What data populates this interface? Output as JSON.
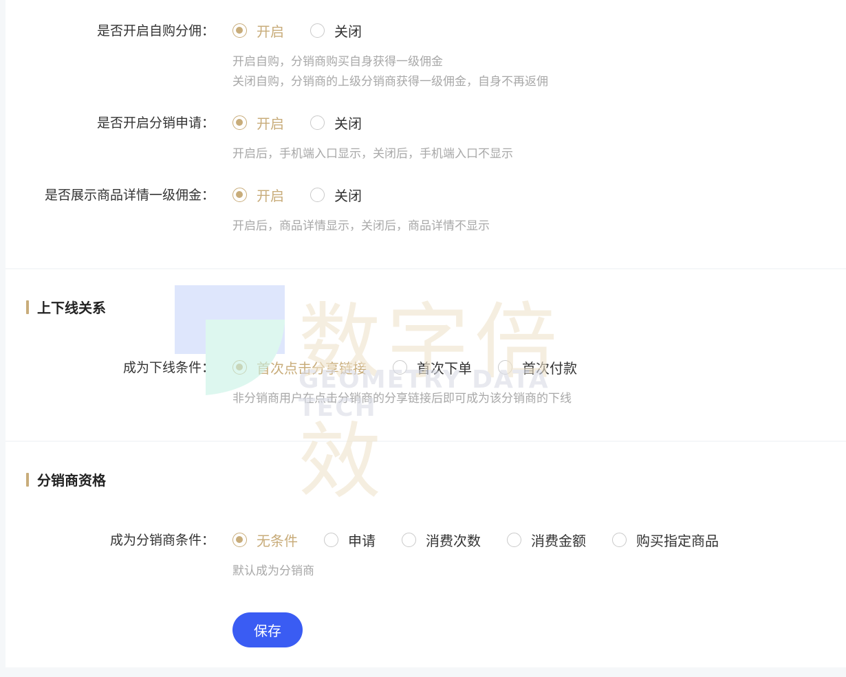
{
  "settings": {
    "self_purchase": {
      "label": "是否开启自购分佣：",
      "options": [
        "开启",
        "关闭"
      ],
      "selected": 0,
      "hint_lines": [
        "开启自购，分销商购买自身获得一级佣金",
        "关闭自购，分销商的上级分销商获得一级佣金，自身不再返佣"
      ]
    },
    "apply": {
      "label": "是否开启分销申请：",
      "options": [
        "开启",
        "关闭"
      ],
      "selected": 0,
      "hint_lines": [
        "开启后，手机端入口显示，关闭后，手机端入口不显示"
      ]
    },
    "show_commission": {
      "label": "是否展示商品详情一级佣金：",
      "options": [
        "开启",
        "关闭"
      ],
      "selected": 0,
      "hint_lines": [
        "开启后，商品详情显示，关闭后，商品详情不显示"
      ]
    }
  },
  "relation": {
    "title": "上下线关系",
    "condition": {
      "label": "成为下线条件：",
      "options": [
        "首次点击分享链接",
        "首次下单",
        "首次付款"
      ],
      "selected": 0,
      "hint_lines": [
        "非分销商用户在点击分销商的分享链接后即可成为该分销商的下线"
      ]
    }
  },
  "qualification": {
    "title": "分销商资格",
    "condition": {
      "label": "成为分销商条件：",
      "options": [
        "无条件",
        "申请",
        "消费次数",
        "消费金额",
        "购买指定商品"
      ],
      "selected": 0,
      "hint_lines": [
        "默认成为分销商"
      ]
    },
    "save_label": "保存"
  },
  "watermark": {
    "text_cn": "数字倍效",
    "text_en": "GEOMETRY DATA TECH"
  },
  "colors": {
    "accent": "#c8ac7a",
    "primary_button": "#3a5cf3",
    "hint": "#a8a8a8"
  }
}
